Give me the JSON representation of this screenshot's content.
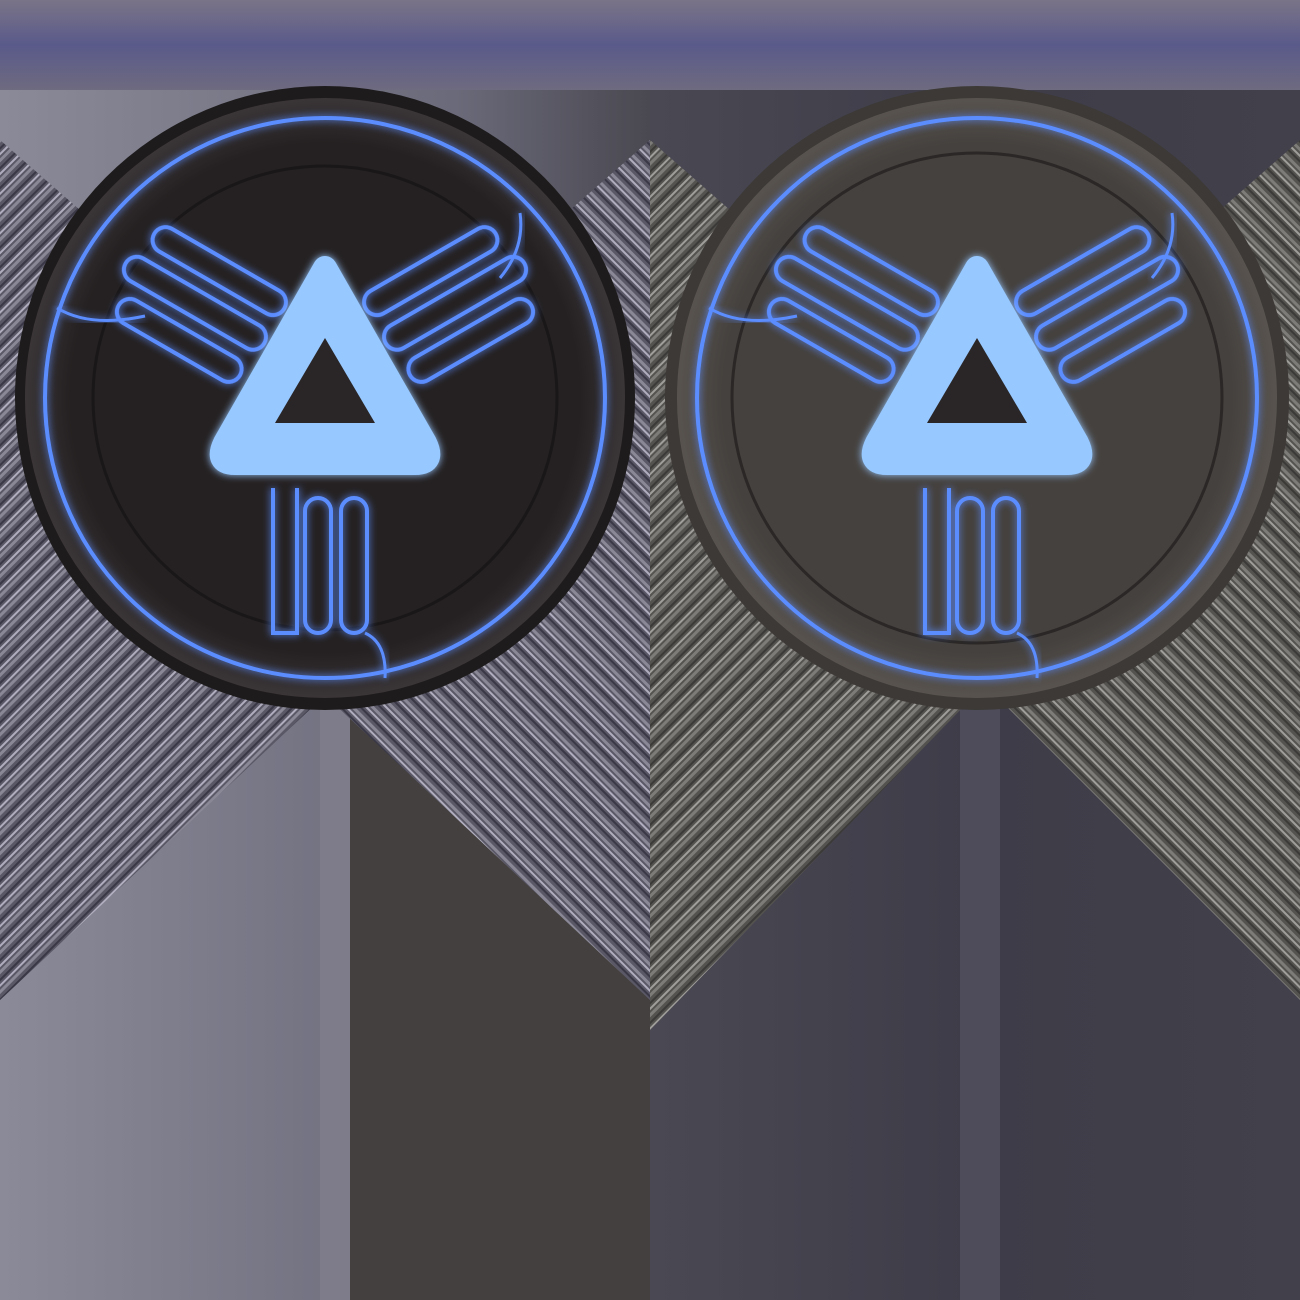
{
  "scene": {
    "description_free": true,
    "panels": [
      {
        "variant": "dark",
        "icons": [
          "triangle-glyph",
          "circuit-ring"
        ],
        "disk_color": "#2a2627",
        "background_color": "#6a6878"
      },
      {
        "variant": "light",
        "icons": [
          "triangle-glyph",
          "circuit-ring"
        ],
        "disk_color": "#4a4643",
        "background_color": "#454350"
      }
    ],
    "glow_color": "#5b8dff",
    "glyph_fill_color": "#97c8ff"
  }
}
